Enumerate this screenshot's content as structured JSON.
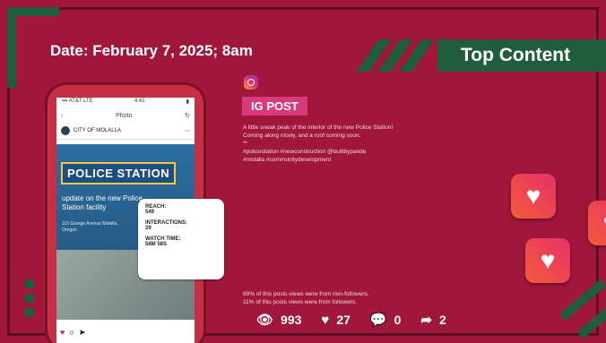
{
  "date": "Date:  February 7, 2025; 8am",
  "top_content": "Top Content",
  "phone": {
    "time": "4:41",
    "status_left": "▪▪▪ AT&T LTE",
    "nav_title": "Photo",
    "account": "CITY OF MOLALLA",
    "banner": "POLICE STATION",
    "update_text": "update on the new Police Station facility",
    "address": "115 Grange Avenue Molalla, Oregon"
  },
  "stats": {
    "reach_label": "REACH:",
    "reach_value": "549",
    "interactions_label": "INTERACTIONS:",
    "interactions_value": "29",
    "watch_label": "WATCH TIME:",
    "watch_value": "58M 58S"
  },
  "ig_post_label": "IG POST",
  "caption": {
    "line1": "A little sneak peak of the interior of the new Police Station!",
    "line2": "Coming along nicely, and a roof coming soon.",
    "line3": "**",
    "line4": "#policestation #newconstruction @builtbypande",
    "line5": "#molalla #communitydevelopment"
  },
  "followers": {
    "line1": "89% of this posts views were from non-followers.",
    "line2": "11% of this posts views were from followers."
  },
  "metrics": {
    "views": "993",
    "likes": "27",
    "comments": "0",
    "shares": "2"
  },
  "colors": {
    "background": "#a0173b",
    "accent_green": "#1f5d3c",
    "ig_pink": "#d93a7a"
  }
}
